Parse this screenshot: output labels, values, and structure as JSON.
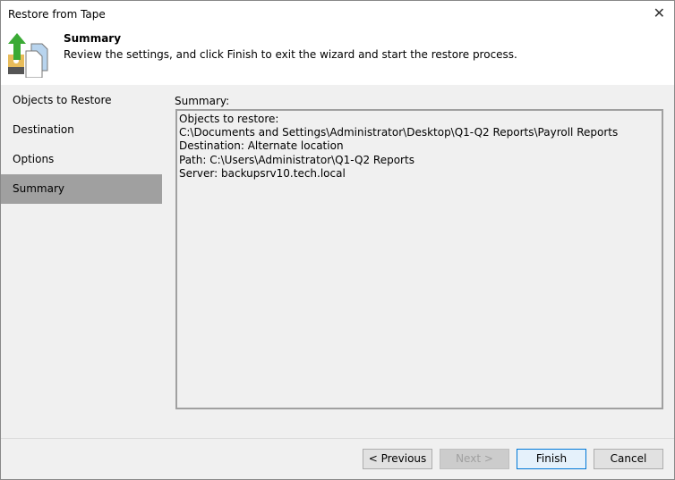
{
  "window": {
    "title": "Restore from Tape"
  },
  "header": {
    "title": "Summary",
    "description": "Review the settings, and click Finish to exit the wizard and start the restore process."
  },
  "steps": [
    {
      "label": "Objects to Restore"
    },
    {
      "label": "Destination"
    },
    {
      "label": "Options"
    },
    {
      "label": "Summary"
    }
  ],
  "summary": {
    "label": "Summary:",
    "lines": [
      "Objects to restore:",
      "C:\\Documents and Settings\\Administrator\\Desktop\\Q1-Q2 Reports\\Payroll Reports",
      "Destination: Alternate location",
      "Path: C:\\Users\\Administrator\\Q1-Q2 Reports",
      "Server: backupsrv10.tech.local"
    ]
  },
  "buttons": {
    "previous": "< Previous",
    "next": "Next >",
    "finish": "Finish",
    "cancel": "Cancel"
  }
}
